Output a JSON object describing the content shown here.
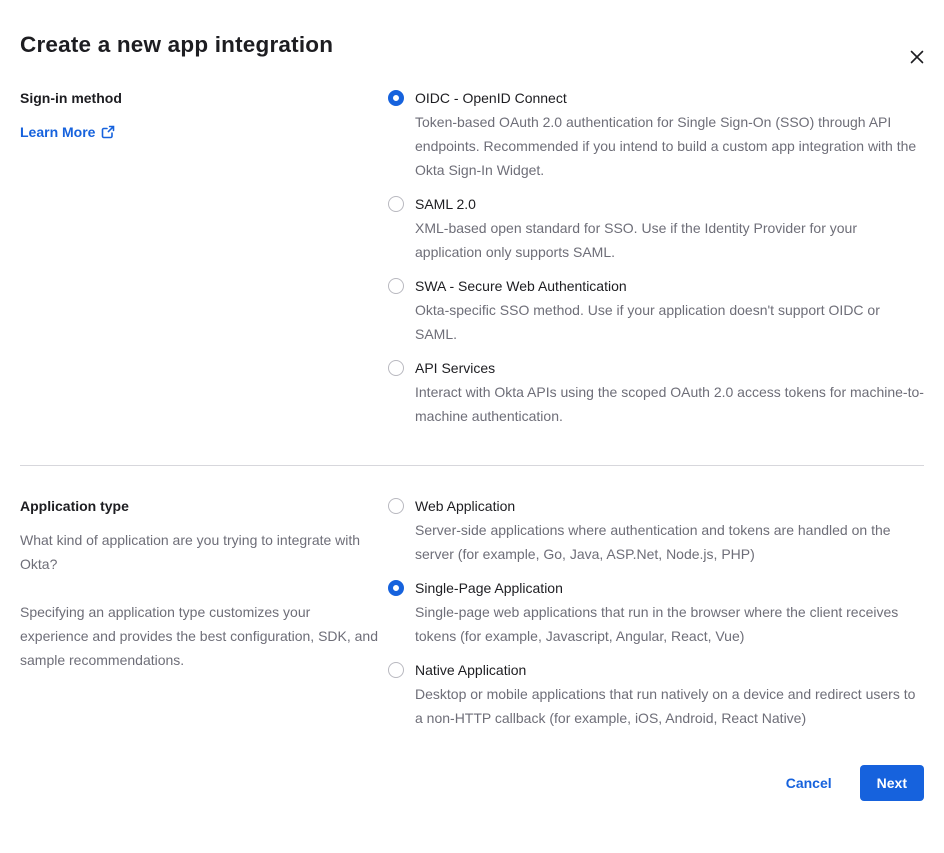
{
  "dialog": {
    "title": "Create a new app integration"
  },
  "colors": {
    "accent_blue": "#1662dd",
    "text_dark": "#1d1d21",
    "text_gray": "#6e6e78",
    "divider_gray": "#d7d7dc"
  },
  "sign_in_method": {
    "label": "Sign-in method",
    "learn_more_label": "Learn More",
    "options": [
      {
        "label": "OIDC - OpenID Connect",
        "description": "Token-based OAuth 2.0 authentication for Single Sign-On (SSO) through API endpoints. Recommended if you intend to build a custom app integration with the Okta Sign-In Widget.",
        "selected": true
      },
      {
        "label": "SAML 2.0",
        "description": "XML-based open standard for SSO. Use if the Identity Provider for your application only supports SAML.",
        "selected": false
      },
      {
        "label": "SWA - Secure Web Authentication",
        "description": "Okta-specific SSO method. Use if your application doesn't support OIDC or SAML.",
        "selected": false
      },
      {
        "label": "API Services",
        "description": "Interact with Okta APIs using the scoped OAuth 2.0 access tokens for machine-to-machine authentication.",
        "selected": false
      }
    ]
  },
  "application_type": {
    "label": "Application type",
    "question": "What kind of application are you trying to integrate with Okta?",
    "note": "Specifying an application type customizes your experience and provides the best configuration, SDK, and sample recommendations.",
    "options": [
      {
        "label": "Web Application",
        "description": "Server-side applications where authentication and tokens are handled on the server (for example, Go, Java, ASP.Net, Node.js, PHP)",
        "selected": false
      },
      {
        "label": "Single-Page Application",
        "description": "Single-page web applications that run in the browser where the client receives tokens (for example, Javascript, Angular, React, Vue)",
        "selected": true
      },
      {
        "label": "Native Application",
        "description": "Desktop or mobile applications that run natively on a device and redirect users to a non-HTTP callback (for example, iOS, Android, React Native)",
        "selected": false
      }
    ]
  },
  "footer": {
    "cancel_label": "Cancel",
    "next_label": "Next"
  }
}
